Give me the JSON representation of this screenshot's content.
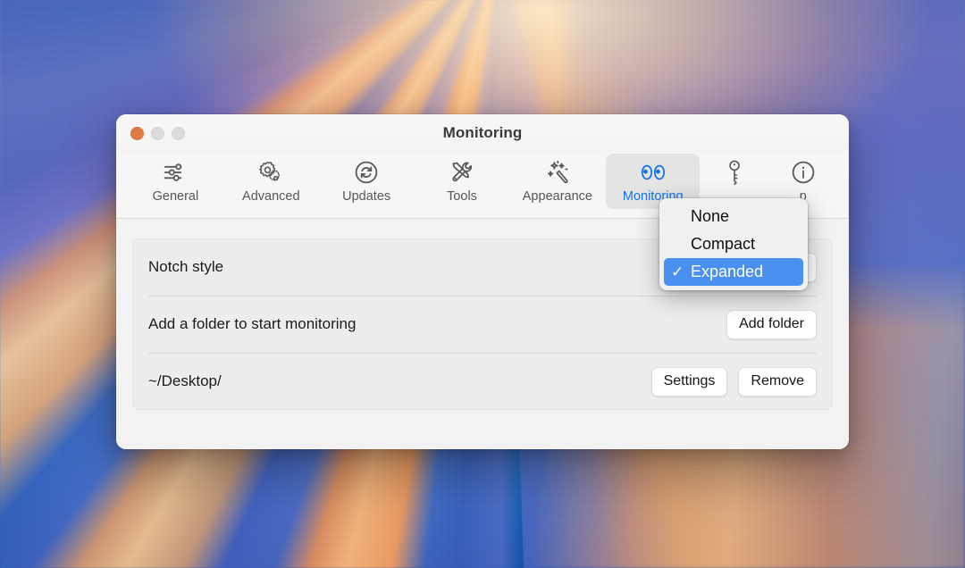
{
  "window": {
    "title": "Monitoring",
    "traffic_lights": [
      "close-button",
      "minimize-button",
      "maximize-button"
    ]
  },
  "toolbar": {
    "tabs": [
      {
        "label": "General",
        "icon": "sliders-icon",
        "active": false
      },
      {
        "label": "Advanced",
        "icon": "gears-icon",
        "active": false
      },
      {
        "label": "Updates",
        "icon": "refresh-icon",
        "active": false
      },
      {
        "label": "Tools",
        "icon": "tools-icon",
        "active": false
      },
      {
        "label": "Appearance",
        "icon": "sparkle-wand-icon",
        "active": false
      },
      {
        "label": "Monitoring",
        "icon": "eyes-icon",
        "active": true
      },
      {
        "label": "",
        "icon": "key-icon",
        "active": false
      },
      {
        "label": "p",
        "icon": "info-icon",
        "active": false
      }
    ]
  },
  "content": {
    "rows": [
      {
        "label": "Notch style",
        "control": "popup-button",
        "value": "Expanded"
      },
      {
        "label": "Add a folder to start monitoring",
        "control": "button",
        "button_label": "Add folder"
      },
      {
        "label": "~/Desktop/",
        "control": "buttons",
        "buttons": [
          "Settings",
          "Remove"
        ]
      }
    ]
  },
  "menu": {
    "name": "notch-style-menu",
    "items": [
      {
        "label": "None",
        "selected": false
      },
      {
        "label": "Compact",
        "selected": false
      },
      {
        "label": "Expanded",
        "selected": true
      }
    ],
    "checkmark": "✓"
  },
  "colors": {
    "accent_blue": "#4a90f0",
    "tab_active_text": "#1273e6",
    "window_bg": "#f2f2f2",
    "card_bg": "#ededed",
    "close_light": "#e07a43"
  }
}
